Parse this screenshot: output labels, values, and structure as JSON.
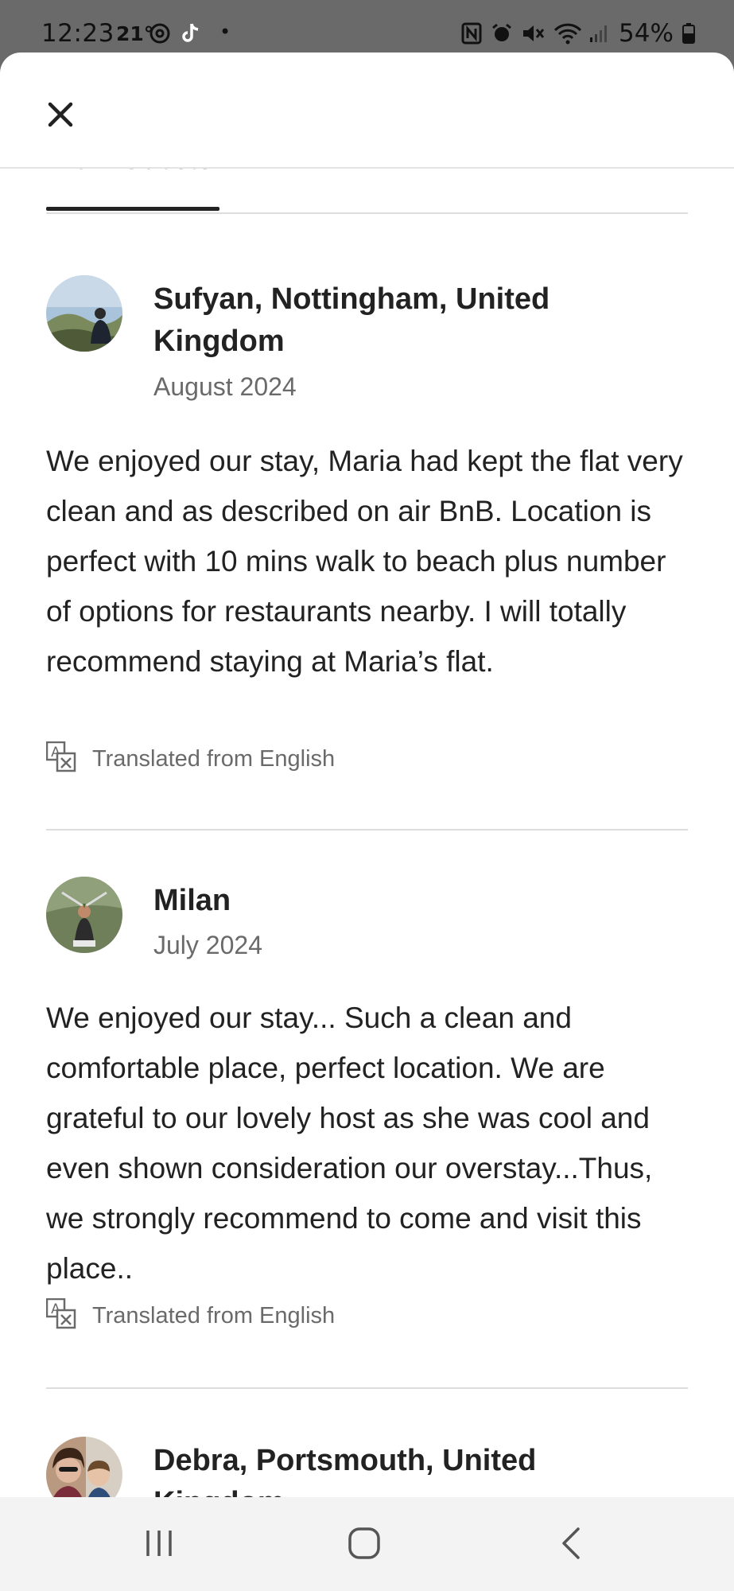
{
  "status_bar": {
    "time": "12:23",
    "temperature": "21°",
    "dot": "•",
    "battery_percent": "54%"
  },
  "header": {
    "tab_label": "From Guests"
  },
  "reviews": [
    {
      "name": "Sufyan, Nottingham, United Kingdom",
      "date": "August 2024",
      "text": "We enjoyed our stay, Maria had kept the flat very clean and as described on air BnB. Location is perfect with 10 mins walk to beach plus number of options for restaurants nearby. I will totally recommend staying at Maria’s flat.",
      "translated_label": "Translated from English"
    },
    {
      "name": "Milan",
      "date": "July 2024",
      "text": "We enjoyed our stay... Such a clean and comfortable place, perfect location. We are grateful to our lovely host as she was cool and  even shown consideration our overstay...Thus, we strongly recommend to come and visit this place..",
      "translated_label": "Translated from English"
    },
    {
      "name": "Debra, Portsmouth, United Kingdom"
    }
  ],
  "icons": {
    "close": "close-icon",
    "translate": "translate-icon",
    "nav_recents": "recents-icon",
    "nav_home": "home-icon",
    "nav_back": "back-icon"
  },
  "colors": {
    "text_primary": "#222222",
    "text_secondary": "#6a6a6a",
    "divider": "#dddddd",
    "status_bar_bg": "#6a6a6a",
    "nav_bar_bg": "#f3f3f4"
  }
}
